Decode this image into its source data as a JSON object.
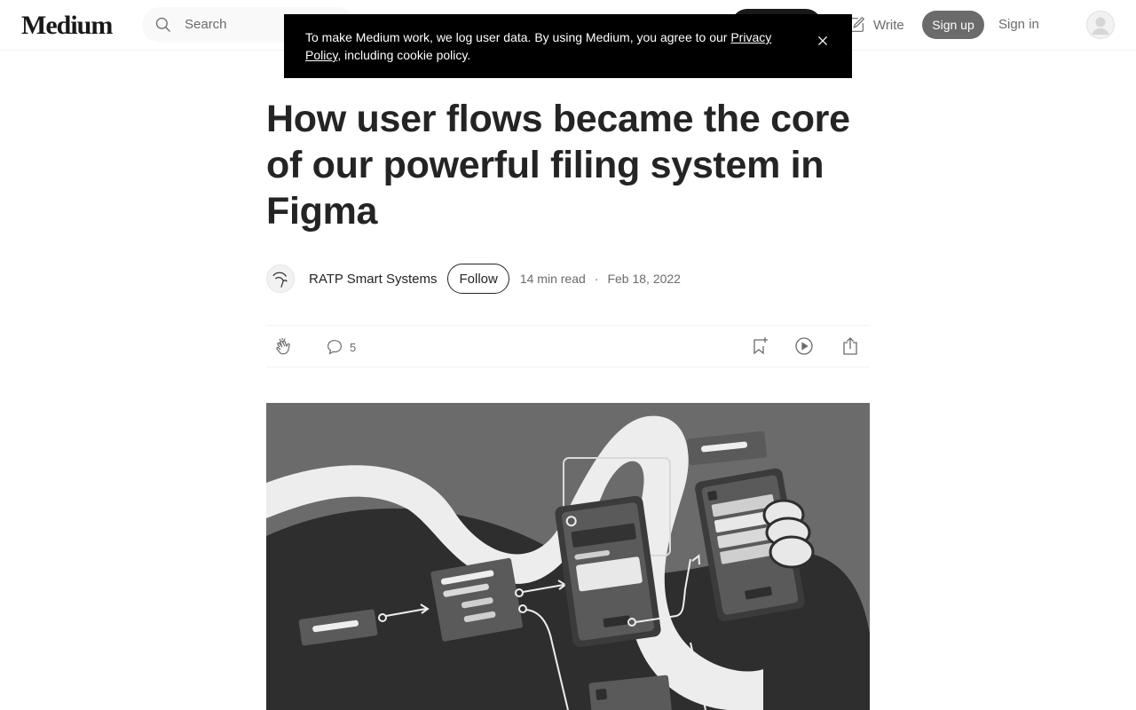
{
  "app": {
    "logo": "Medium"
  },
  "nav": {
    "search_placeholder": "Search",
    "write_label": "Write",
    "signup_label": "Sign up",
    "signin_label": "Sign in"
  },
  "cookie_banner": {
    "text_before": "To make Medium work, we log user data. By using Medium, you agree to our ",
    "link_text": "Privacy Policy",
    "text_after": ", including cookie policy."
  },
  "article": {
    "title": "How user flows became the core of our powerful filing system in Figma",
    "author": "RATP Smart Systems",
    "follow_label": "Follow",
    "read_time": "14 min read",
    "separator": "·",
    "date": "Feb 18, 2022",
    "comments_count": "5"
  },
  "colors": {
    "text": "#242424",
    "muted": "#6b6b6b",
    "banner_bg": "#000000",
    "signup_bg": "#6b6b6b"
  },
  "icons": {
    "search": "search-icon",
    "write": "pencil-icon",
    "close": "close-icon",
    "clap": "clap-icon",
    "comment": "comment-icon",
    "bookmark": "bookmark-icon",
    "listen": "play-icon",
    "share": "share-icon"
  }
}
